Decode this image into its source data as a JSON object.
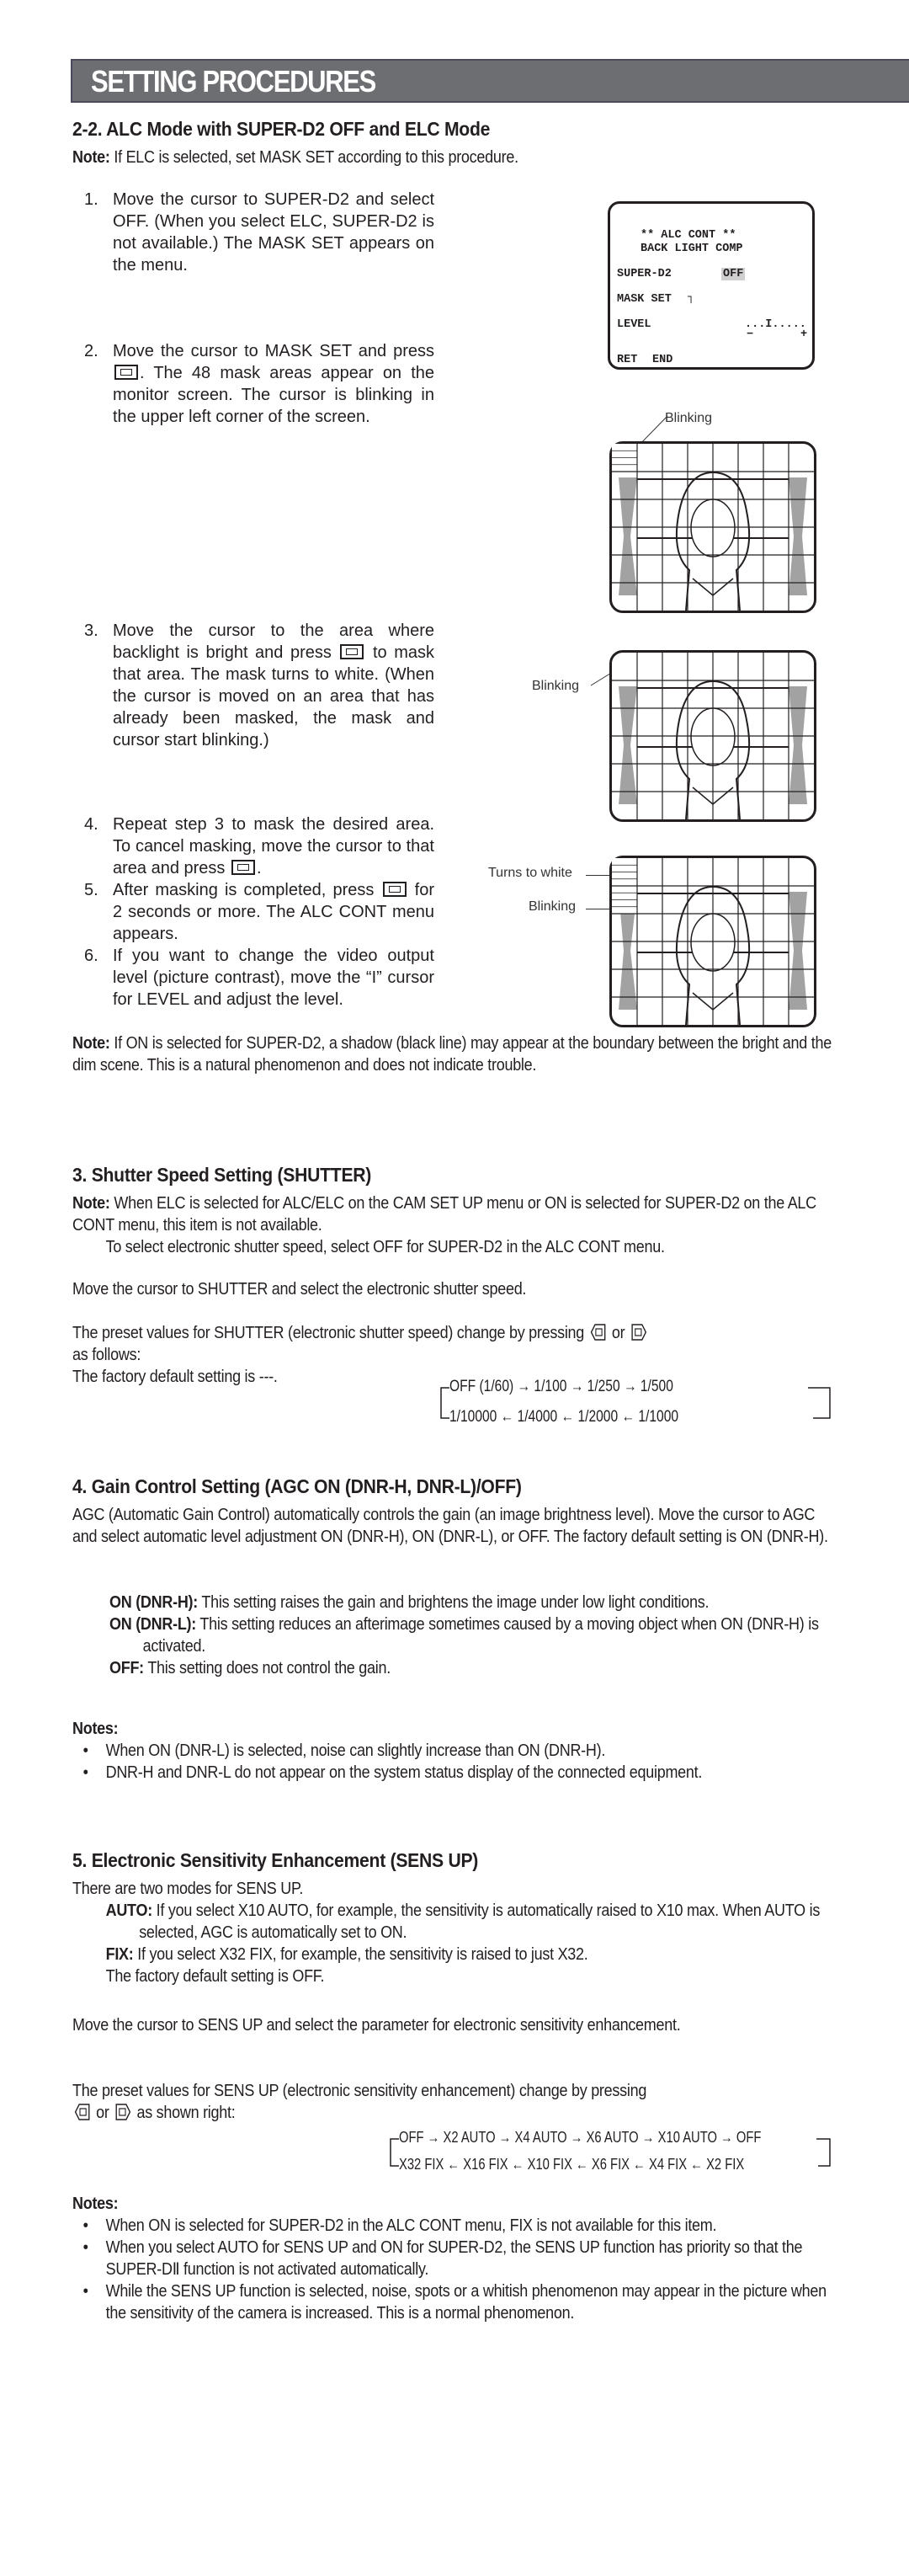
{
  "header": {
    "title": "SETTING PROCEDURES"
  },
  "section_2_2": {
    "title": "2-2. ALC Mode with SUPER-D2 OFF and ELC Mode",
    "note_label": "Note:",
    "note_text": " If ELC is selected, set MASK SET according to this procedure.",
    "steps": [
      {
        "num": "1.",
        "text": "Move the cursor to SUPER-D2 and select OFF. (When you select ELC, SUPER-D2 is not available.) The MASK SET appears on the menu."
      },
      {
        "num": "2.",
        "text_a": "Move the cursor to MASK SET and press ",
        "text_b": ". The 48 mask areas appear on the monitor screen. The cursor is blinking in the upper left corner of the screen."
      },
      {
        "num": "3.",
        "text_a": "Move the cursor to the area where backlight is bright and press ",
        "text_b": " to mask that area. The mask turns to white. (When the cursor is moved on an area that has already been masked, the mask and cursor start blinking.)"
      },
      {
        "num": "4.",
        "text_a": "Repeat step 3 to mask the desired area. To cancel masking, move the cursor to that area and press ",
        "text_b": "."
      },
      {
        "num": "5.",
        "text_a": "After masking is completed, press ",
        "text_b": " for 2 seconds or more. The ALC CONT menu appears."
      },
      {
        "num": "6.",
        "text": "If you want to change the video output level (picture contrast), move the “I” cursor for LEVEL and adjust the level."
      }
    ],
    "osd_menu": {
      "title_line1": "** ALC CONT **",
      "title_line2": "BACK LIGHT COMP",
      "super_d2_label": "SUPER-D2",
      "super_d2_value": "OFF",
      "mask_set_label": "MASK SET",
      "mask_set_symbol": "┐",
      "level_label": "LEVEL",
      "level_scale": "...I.....",
      "level_minus": "−",
      "level_plus": "+",
      "ret": "RET",
      "end": "END"
    },
    "figure_labels": {
      "fig1_blinking": "Blinking",
      "fig2_blinking": "Blinking",
      "fig3_turns_white": "Turns to white",
      "fig3_blinking": "Blinking"
    },
    "note2_label": "Note:",
    "note2_text": " If ON is selected for SUPER-D2, a shadow (black line) may appear at the boundary between the bright and the dim scene. This is a natural phenomenon and does not indicate trouble."
  },
  "section_3": {
    "title": "3. Shutter Speed Setting (SHUTTER)",
    "note_label": "Note:",
    "note_text": " When ELC is selected for ALC/ELC on the CAM SET UP menu or ON is selected for SUPER-D2 on the ALC CONT menu, this item is not available.",
    "note_text2": "To select electronic shutter speed, select OFF for SUPER-D2 in the ALC CONT menu.",
    "para1": "Move the cursor to SHUTTER and select the electronic shutter speed.",
    "para2_a": "The preset values for SHUTTER (electronic shutter speed) change by pressing ",
    "para2_or": " or ",
    "para2_b": " as follows:",
    "para3": "The factory default setting is ---.",
    "flow_top": [
      "OFF (1/60)",
      "1/100",
      "1/250",
      "1/500"
    ],
    "flow_bottom": [
      "1/10000",
      "1/4000",
      "1/2000",
      "1/1000"
    ]
  },
  "section_4": {
    "title": "4. Gain Control Setting (AGC ON (DNR-H, DNR-L)/OFF)",
    "para1": "AGC (Automatic Gain Control) automatically controls the gain (an image brightness level). Move the cursor to AGC and select automatic level adjustment ON (DNR-H), ON (DNR-L), or OFF. The factory default setting is ON (DNR-H).",
    "options": [
      {
        "label": "ON (DNR-H):",
        "text": " This setting raises the gain and brightens the image under low light conditions."
      },
      {
        "label": "ON (DNR-L):",
        "text": " This setting reduces an afterimage sometimes caused by a moving object when ON (DNR-H) is activated."
      },
      {
        "label": "OFF:",
        "text": " This setting does not control the gain."
      }
    ],
    "notes_label": "Notes:",
    "notes": [
      "When ON (DNR-L) is selected, noise can slightly increase than ON (DNR-H).",
      "DNR-H and DNR-L do not appear on the system status display of the connected equipment."
    ]
  },
  "section_5": {
    "title": "5. Electronic Sensitivity Enhancement (SENS UP)",
    "intro": "There are two modes for SENS UP.",
    "auto_label": "AUTO:",
    "auto_text": " If you select X10 AUTO, for example, the sensitivity is automatically raised to X10 max. When AUTO is selected, AGC is automatically set to ON.",
    "fix_label": "FIX:",
    "fix_text": " If you select X32 FIX, for example, the sensitivity is raised to just X32.",
    "default_text": "The factory default setting is OFF.",
    "para1": "Move the cursor to SENS UP and select the parameter for electronic sensitivity enhancement.",
    "para2_a": "The preset values for SENS UP (electronic sensitivity enhancement) change by pressing",
    "para2_or": " or ",
    "para2_b": " as shown right:",
    "flow_top": [
      "OFF",
      "X2 AUTO",
      "X4 AUTO",
      "X6 AUTO",
      "X10 AUTO",
      "OFF"
    ],
    "flow_bottom": [
      "X32 FIX",
      "X16 FIX",
      "X10 FIX",
      "X6 FIX",
      "X4 FIX",
      "X2 FIX"
    ],
    "notes_label": "Notes:",
    "notes": [
      "When ON is selected for SUPER-D2 in the ALC CONT menu, FIX is not available for this item.",
      "When you select AUTO for SENS UP and ON for SUPER-D2, the SENS UP function has priority so that the SUPER-DⅡ function is not activated automatically.",
      "While the SENS UP function is selected, noise, spots or a whitish phenomenon may appear in the picture when the sensitivity of the camera is increased. This is a normal phenomenon."
    ]
  }
}
